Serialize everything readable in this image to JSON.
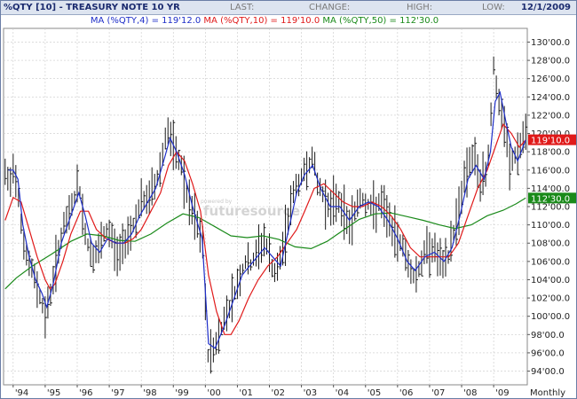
{
  "header": {
    "symbol": "%QTY [10] - TREASURY NOTE 10 YR",
    "last_label": "LAST:",
    "change_label": "CHANGE:",
    "high_label": "HIGH:",
    "low_label": "LOW:",
    "date": "12/1/2009"
  },
  "legend": {
    "ma4": "MA (%QTY,4) = 119'12.0",
    "ma10": "MA (%QTY,10) = 119'10.0",
    "ma50": "MA (%QTY,50) = 112'30.0"
  },
  "watermark": "futuresource",
  "watermark_small": "powered by",
  "colors": {
    "price": "#1a1a1a",
    "ma4": "#1e2ec8",
    "ma10": "#e01a1a",
    "ma50": "#1a8a1a",
    "grid": "#c9c9c9",
    "header_bg": "#dde4f0"
  },
  "chart_data": {
    "type": "line",
    "y_ticks": [
      "94'00.0",
      "96'00.0",
      "98'00.0",
      "100'00.0",
      "102'00.0",
      "104'00.0",
      "106'00.0",
      "108'00.0",
      "110'00.0",
      "112'00.0",
      "114'00.0",
      "116'00.0",
      "118'00.0",
      "120'00.0",
      "122'00.0",
      "124'00.0",
      "126'00.0",
      "128'00.0",
      "130'00.0"
    ],
    "x_ticks": [
      "'94",
      "'95",
      "'96",
      "'97",
      "'98",
      "'99",
      "'00",
      "'01",
      "'02",
      "'03",
      "'04",
      "'05",
      "'06",
      "'07",
      "'08",
      "'09"
    ],
    "frequency_label": "Monthly",
    "ylim": [
      92.5,
      131.5
    ],
    "xlim": [
      1993.7,
      2010.05
    ],
    "grid": true,
    "last_value_labels": [
      {
        "text": "119'10.0",
        "value": 119.3125,
        "series": "ma10"
      },
      {
        "text": "112'30.0",
        "value": 112.9375,
        "series": "ma50"
      }
    ],
    "price_anchors": [
      [
        1993.75,
        115.5
      ],
      [
        1993.9,
        114.2
      ],
      [
        1994.0,
        116.5
      ],
      [
        1994.15,
        114.0
      ],
      [
        1994.3,
        108.5
      ],
      [
        1994.45,
        106.0
      ],
      [
        1994.6,
        105.0
      ],
      [
        1994.75,
        103.2
      ],
      [
        1994.9,
        101.5
      ],
      [
        1995.0,
        100.0
      ],
      [
        1995.1,
        101.5
      ],
      [
        1995.25,
        104.0
      ],
      [
        1995.4,
        107.0
      ],
      [
        1995.55,
        109.5
      ],
      [
        1995.7,
        110.5
      ],
      [
        1995.85,
        112.5
      ],
      [
        1996.0,
        114.0
      ],
      [
        1996.1,
        113.5
      ],
      [
        1996.2,
        110.0
      ],
      [
        1996.35,
        107.5
      ],
      [
        1996.5,
        106.5
      ],
      [
        1996.65,
        107.0
      ],
      [
        1996.8,
        108.5
      ],
      [
        1996.95,
        109.5
      ],
      [
        1997.1,
        108.5
      ],
      [
        1997.25,
        106.5
      ],
      [
        1997.4,
        107.5
      ],
      [
        1997.55,
        109.0
      ],
      [
        1997.7,
        109.5
      ],
      [
        1997.85,
        111.0
      ],
      [
        1998.0,
        112.5
      ],
      [
        1998.15,
        112.5
      ],
      [
        1998.3,
        113.5
      ],
      [
        1998.45,
        114.5
      ],
      [
        1998.6,
        116.5
      ],
      [
        1998.75,
        119.5
      ],
      [
        1998.85,
        120.5
      ],
      [
        1998.95,
        118.5
      ],
      [
        1999.1,
        117.5
      ],
      [
        1999.25,
        116.5
      ],
      [
        1999.4,
        113.5
      ],
      [
        1999.55,
        111.5
      ],
      [
        1999.7,
        110.5
      ],
      [
        1999.85,
        108.5
      ],
      [
        1999.95,
        107.5
      ],
      [
        2000.05,
        95.5
      ],
      [
        2000.15,
        96.0
      ],
      [
        2000.3,
        96.8
      ],
      [
        2000.45,
        98.0
      ],
      [
        2000.6,
        100.0
      ],
      [
        2000.8,
        101.5
      ],
      [
        2000.95,
        103.0
      ],
      [
        2001.1,
        104.5
      ],
      [
        2001.25,
        106.0
      ],
      [
        2001.4,
        105.5
      ],
      [
        2001.55,
        106.5
      ],
      [
        2001.7,
        107.5
      ],
      [
        2001.85,
        108.5
      ],
      [
        2002.0,
        106.5
      ],
      [
        2002.15,
        104.5
      ],
      [
        2002.3,
        105.5
      ],
      [
        2002.45,
        108.0
      ],
      [
        2002.6,
        111.0
      ],
      [
        2002.75,
        113.5
      ],
      [
        2002.9,
        114.5
      ],
      [
        2003.05,
        115.5
      ],
      [
        2003.2,
        116.5
      ],
      [
        2003.35,
        117.5
      ],
      [
        2003.5,
        114.5
      ],
      [
        2003.65,
        113.5
      ],
      [
        2003.8,
        112.5
      ],
      [
        2003.95,
        111.5
      ],
      [
        2004.1,
        113.0
      ],
      [
        2004.25,
        112.0
      ],
      [
        2004.4,
        110.5
      ],
      [
        2004.55,
        110.0
      ],
      [
        2004.7,
        112.0
      ],
      [
        2004.85,
        113.0
      ],
      [
        2005.0,
        112.5
      ],
      [
        2005.15,
        112.0
      ],
      [
        2005.3,
        111.5
      ],
      [
        2005.45,
        112.5
      ],
      [
        2005.6,
        111.5
      ],
      [
        2005.75,
        110.5
      ],
      [
        2005.9,
        108.5
      ],
      [
        2006.05,
        108.5
      ],
      [
        2006.2,
        107.5
      ],
      [
        2006.35,
        105.5
      ],
      [
        2006.5,
        104.5
      ],
      [
        2006.65,
        105.0
      ],
      [
        2006.8,
        106.5
      ],
      [
        2006.95,
        107.5
      ],
      [
        2007.1,
        107.5
      ],
      [
        2007.25,
        106.5
      ],
      [
        2007.4,
        105.5
      ],
      [
        2007.55,
        106.0
      ],
      [
        2007.7,
        108.5
      ],
      [
        2007.85,
        110.5
      ],
      [
        2008.0,
        113.5
      ],
      [
        2008.15,
        116.0
      ],
      [
        2008.3,
        117.5
      ],
      [
        2008.45,
        116.5
      ],
      [
        2008.6,
        114.5
      ],
      [
        2008.75,
        115.5
      ],
      [
        2008.85,
        118.5
      ],
      [
        2008.95,
        124.0
      ],
      [
        2009.0,
        127.5
      ],
      [
        2009.1,
        124.5
      ],
      [
        2009.2,
        122.5
      ],
      [
        2009.35,
        120.5
      ],
      [
        2009.5,
        116.5
      ],
      [
        2009.65,
        117.5
      ],
      [
        2009.8,
        118.0
      ],
      [
        2009.9,
        119.5
      ],
      [
        2010.0,
        119.5
      ]
    ],
    "ma4_anchors": [
      [
        1993.85,
        116.0
      ],
      [
        1994.0,
        116.0
      ],
      [
        1994.15,
        115.0
      ],
      [
        1994.3,
        110.0
      ],
      [
        1994.5,
        106.5
      ],
      [
        1994.7,
        104.0
      ],
      [
        1994.9,
        102.5
      ],
      [
        1995.05,
        101.0
      ],
      [
        1995.25,
        103.5
      ],
      [
        1995.5,
        108.0
      ],
      [
        1995.8,
        111.0
      ],
      [
        1996.05,
        113.5
      ],
      [
        1996.25,
        111.0
      ],
      [
        1996.45,
        108.0
      ],
      [
        1996.7,
        107.0
      ],
      [
        1996.95,
        108.5
      ],
      [
        1997.2,
        108.0
      ],
      [
        1997.45,
        108.0
      ],
      [
        1997.7,
        109.0
      ],
      [
        1997.95,
        111.0
      ],
      [
        1998.2,
        112.5
      ],
      [
        1998.45,
        114.0
      ],
      [
        1998.7,
        117.0
      ],
      [
        1998.9,
        119.5
      ],
      [
        1999.1,
        118.0
      ],
      [
        1999.35,
        115.5
      ],
      [
        1999.6,
        112.0
      ],
      [
        1999.9,
        108.5
      ],
      [
        2000.1,
        97.0
      ],
      [
        2000.3,
        96.5
      ],
      [
        2000.6,
        99.0
      ],
      [
        2000.9,
        102.0
      ],
      [
        2001.15,
        104.5
      ],
      [
        2001.5,
        106.0
      ],
      [
        2001.85,
        107.5
      ],
      [
        2002.1,
        106.5
      ],
      [
        2002.35,
        105.5
      ],
      [
        2002.6,
        109.5
      ],
      [
        2002.85,
        113.5
      ],
      [
        2003.1,
        115.5
      ],
      [
        2003.35,
        116.5
      ],
      [
        2003.6,
        114.0
      ],
      [
        2003.9,
        112.0
      ],
      [
        2004.2,
        112.0
      ],
      [
        2004.5,
        110.5
      ],
      [
        2004.8,
        112.0
      ],
      [
        2005.1,
        112.5
      ],
      [
        2005.4,
        112.0
      ],
      [
        2005.7,
        110.5
      ],
      [
        2006.0,
        108.5
      ],
      [
        2006.3,
        106.0
      ],
      [
        2006.55,
        105.0
      ],
      [
        2006.85,
        106.5
      ],
      [
        2007.15,
        107.0
      ],
      [
        2007.45,
        106.0
      ],
      [
        2007.7,
        107.5
      ],
      [
        2007.95,
        111.0
      ],
      [
        2008.2,
        115.0
      ],
      [
        2008.45,
        116.5
      ],
      [
        2008.7,
        115.0
      ],
      [
        2008.9,
        118.0
      ],
      [
        2009.05,
        123.5
      ],
      [
        2009.2,
        124.5
      ],
      [
        2009.4,
        121.0
      ],
      [
        2009.55,
        118.5
      ],
      [
        2009.75,
        117.0
      ],
      [
        2010.0,
        119.3
      ]
    ],
    "ma10_anchors": [
      [
        1993.75,
        110.5
      ],
      [
        1994.0,
        113.0
      ],
      [
        1994.25,
        112.5
      ],
      [
        1994.5,
        109.5
      ],
      [
        1994.75,
        106.5
      ],
      [
        1995.0,
        104.0
      ],
      [
        1995.15,
        103.0
      ],
      [
        1995.3,
        103.5
      ],
      [
        1995.55,
        106.0
      ],
      [
        1995.8,
        109.0
      ],
      [
        1996.1,
        111.5
      ],
      [
        1996.35,
        111.5
      ],
      [
        1996.6,
        109.5
      ],
      [
        1996.9,
        108.5
      ],
      [
        1997.2,
        108.0
      ],
      [
        1997.5,
        108.0
      ],
      [
        1997.75,
        108.5
      ],
      [
        1998.0,
        109.5
      ],
      [
        1998.3,
        111.5
      ],
      [
        1998.6,
        113.5
      ],
      [
        1998.85,
        116.5
      ],
      [
        1999.1,
        118.0
      ],
      [
        1999.35,
        117.0
      ],
      [
        1999.6,
        114.5
      ],
      [
        1999.85,
        111.5
      ],
      [
        2000.1,
        104.5
      ],
      [
        2000.35,
        100.5
      ],
      [
        2000.6,
        98.0
      ],
      [
        2000.8,
        98.0
      ],
      [
        2001.05,
        99.5
      ],
      [
        2001.35,
        102.0
      ],
      [
        2001.65,
        104.0
      ],
      [
        2001.95,
        105.5
      ],
      [
        2002.25,
        106.5
      ],
      [
        2002.55,
        108.0
      ],
      [
        2002.85,
        109.5
      ],
      [
        2003.1,
        111.5
      ],
      [
        2003.4,
        114.0
      ],
      [
        2003.7,
        114.5
      ],
      [
        2004.0,
        113.5
      ],
      [
        2004.3,
        112.5
      ],
      [
        2004.6,
        112.0
      ],
      [
        2004.9,
        112.0
      ],
      [
        2005.2,
        112.5
      ],
      [
        2005.5,
        112.0
      ],
      [
        2005.8,
        111.0
      ],
      [
        2006.1,
        109.5
      ],
      [
        2006.4,
        107.5
      ],
      [
        2006.7,
        106.5
      ],
      [
        2007.0,
        106.5
      ],
      [
        2007.3,
        106.5
      ],
      [
        2007.6,
        106.5
      ],
      [
        2007.9,
        108.0
      ],
      [
        2008.2,
        111.0
      ],
      [
        2008.5,
        114.0
      ],
      [
        2008.8,
        116.0
      ],
      [
        2009.05,
        118.5
      ],
      [
        2009.3,
        121.0
      ],
      [
        2009.55,
        120.0
      ],
      [
        2009.8,
        118.5
      ],
      [
        2010.0,
        119.3
      ]
    ],
    "ma50_anchors": [
      [
        1993.75,
        103.0
      ],
      [
        1994.1,
        104.2
      ],
      [
        1994.6,
        105.5
      ],
      [
        1995.2,
        106.8
      ],
      [
        1995.8,
        108.2
      ],
      [
        1996.3,
        109.0
      ],
      [
        1996.8,
        108.8
      ],
      [
        1997.3,
        108.3
      ],
      [
        1997.8,
        108.2
      ],
      [
        1998.3,
        109.0
      ],
      [
        1998.8,
        110.2
      ],
      [
        1999.3,
        111.2
      ],
      [
        1999.8,
        110.8
      ],
      [
        2000.3,
        109.8
      ],
      [
        2000.8,
        108.8
      ],
      [
        2001.3,
        108.6
      ],
      [
        2001.8,
        108.8
      ],
      [
        2002.3,
        108.4
      ],
      [
        2002.8,
        107.6
      ],
      [
        2003.3,
        107.4
      ],
      [
        2003.8,
        108.2
      ],
      [
        2004.3,
        109.4
      ],
      [
        2004.8,
        110.6
      ],
      [
        2005.3,
        111.2
      ],
      [
        2005.8,
        111.3
      ],
      [
        2006.3,
        110.9
      ],
      [
        2006.8,
        110.5
      ],
      [
        2007.3,
        110.0
      ],
      [
        2007.8,
        109.6
      ],
      [
        2008.3,
        110.0
      ],
      [
        2008.8,
        111.0
      ],
      [
        2009.3,
        111.6
      ],
      [
        2009.7,
        112.3
      ],
      [
        2010.0,
        112.95
      ]
    ]
  }
}
